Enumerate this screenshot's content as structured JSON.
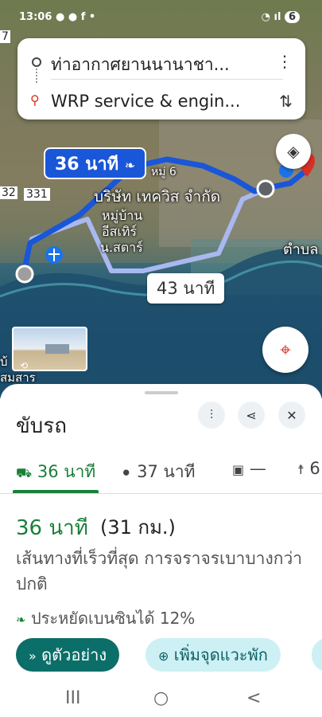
{
  "status_bar": {
    "time": "13:06",
    "right": "6"
  },
  "search": {
    "origin": "ท่าอากาศยานนานาชา...",
    "destination": "WRP service & engin...",
    "more_icon": "more-vert-icon",
    "swap_icon": "swap-icon"
  },
  "map": {
    "main_time": "36 นาที",
    "alt_time": "43 นาที",
    "label_company": "บริษัท เทควิส จำกัด",
    "label_village1": "หมู่บ้าน",
    "label_village2": "อีสเทิร์",
    "label_village3": "น.สตาร์",
    "label_moo6": "หมู่ 6",
    "label_tambon": "ตำบล",
    "label_331": "331",
    "label_32": "32",
    "label_7": "7",
    "label_bottom1": "บ้",
    "label_bottom2": "สมสาร",
    "route_color": "#1a56d8",
    "alt_route_color": "#aab8f0"
  },
  "sheet": {
    "title": "ขับรถ",
    "modes": {
      "drive": "36 นาที",
      "motorcycle": "37 นาที",
      "transit": "—",
      "walk": "6"
    },
    "duration": "36 นาที",
    "distance": "(31 กม.)",
    "description": "เส้นทางที่เร็วที่สุด การจราจรเบาบางกว่าปกติ",
    "eco": "ประหยัดเบนซินได้ 12%",
    "preview_label": "ดูตัวอย่าง",
    "add_stop_label": "เพิ่มจุดแวะพัก",
    "accent_color": "#188038",
    "button_color": "#0b6e69"
  },
  "nav": {
    "recents": "III",
    "home": "○",
    "back": "<"
  }
}
